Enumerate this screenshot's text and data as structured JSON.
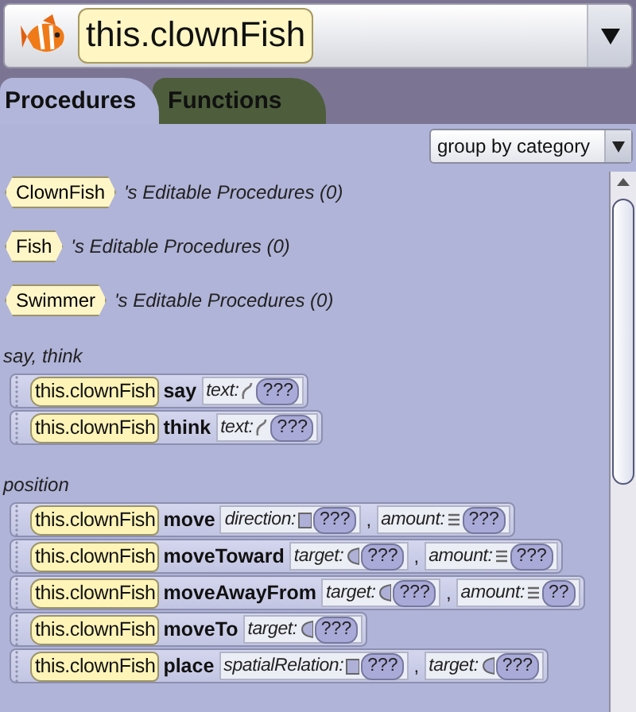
{
  "header": {
    "title": "this.clownFish"
  },
  "tabs": [
    {
      "label": "Procedures",
      "selected": true
    },
    {
      "label": "Functions",
      "selected": false
    }
  ],
  "grouping": {
    "value": "group by category"
  },
  "editable": [
    {
      "type": "ClownFish",
      "text": "'s Editable Procedures (0)"
    },
    {
      "type": "Fish",
      "text": "'s Editable Procedures (0)"
    },
    {
      "type": "Swimmer",
      "text": "'s Editable Procedures (0)"
    }
  ],
  "categories": [
    {
      "name": "say, think",
      "procedures": [
        {
          "target": "this.clownFish",
          "method": "say",
          "params": [
            {
              "kind": "text",
              "name": "text:",
              "value": "???"
            }
          ]
        },
        {
          "target": "this.clownFish",
          "method": "think",
          "params": [
            {
              "kind": "text",
              "name": "text:",
              "value": "???"
            }
          ]
        }
      ]
    },
    {
      "name": "position",
      "procedures": [
        {
          "target": "this.clownFish",
          "method": "move",
          "params": [
            {
              "kind": "enum",
              "name": "direction:",
              "value": "???"
            },
            {
              "kind": "number",
              "lead": ",",
              "name": "amount:",
              "value": "???"
            }
          ]
        },
        {
          "target": "this.clownFish",
          "method": "moveToward",
          "params": [
            {
              "kind": "object",
              "name": "target:",
              "value": "???"
            },
            {
              "kind": "number",
              "lead": ",",
              "name": "amount:",
              "value": "???"
            }
          ]
        },
        {
          "target": "this.clownFish",
          "method": "moveAwayFrom",
          "params": [
            {
              "kind": "object",
              "name": "target:",
              "value": "???"
            },
            {
              "kind": "number",
              "lead": ",",
              "name": "amount:",
              "value": "??"
            }
          ]
        },
        {
          "target": "this.clownFish",
          "method": "moveTo",
          "params": [
            {
              "kind": "object",
              "name": "target:",
              "value": "???"
            }
          ]
        },
        {
          "target": "this.clownFish",
          "method": "place",
          "params": [
            {
              "kind": "enum",
              "name": "spatialRelation:",
              "value": "???"
            },
            {
              "kind": "object",
              "lead": ",",
              "name": "target:",
              "value": "???"
            }
          ]
        }
      ]
    }
  ]
}
